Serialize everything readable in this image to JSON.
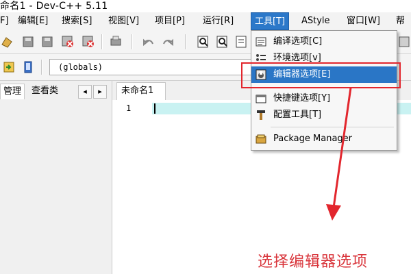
{
  "window": {
    "title": "命名1 - Dev-C++ 5.11"
  },
  "menu": {
    "items": [
      {
        "label": "F]"
      },
      {
        "label": "编辑[E]"
      },
      {
        "label": "搜索[S]"
      },
      {
        "label": "视图[V]"
      },
      {
        "label": "项目[P]"
      },
      {
        "label": "运行[R]"
      },
      {
        "label": "工具[T]"
      },
      {
        "label": "AStyle"
      },
      {
        "label": "窗口[W]"
      },
      {
        "label": "帮"
      }
    ],
    "active_index": 6
  },
  "toolbar2": {
    "scope_combo": "(globals)"
  },
  "left_panel": {
    "tabs": [
      {
        "label": "管理"
      },
      {
        "label": "查看类"
      }
    ],
    "nav_prev": "◂",
    "nav_next": "▸"
  },
  "editor": {
    "tab_label": "未命名1",
    "line_numbers": [
      "1"
    ],
    "current_line_color": "#c9f2f2"
  },
  "tools_menu": {
    "items": [
      {
        "label": "编译选项[C]",
        "icon": "compiler-options-icon"
      },
      {
        "label": "环境选项[v]",
        "icon": "environment-options-icon"
      },
      {
        "label": "编辑器选项[E]",
        "icon": "editor-options-icon",
        "selected": true
      },
      {
        "label": "快捷键选项[Y]",
        "icon": "shortcut-options-icon"
      },
      {
        "label": "配置工具[T]",
        "icon": "configure-tools-icon"
      },
      {
        "label": "Package Manager",
        "icon": "package-manager-icon"
      }
    ]
  },
  "annotation": {
    "text": "选择编辑器选项",
    "color": "#d9363c",
    "box_color": "#e2262d"
  },
  "colors": {
    "menu_highlight": "#2a76c6"
  }
}
